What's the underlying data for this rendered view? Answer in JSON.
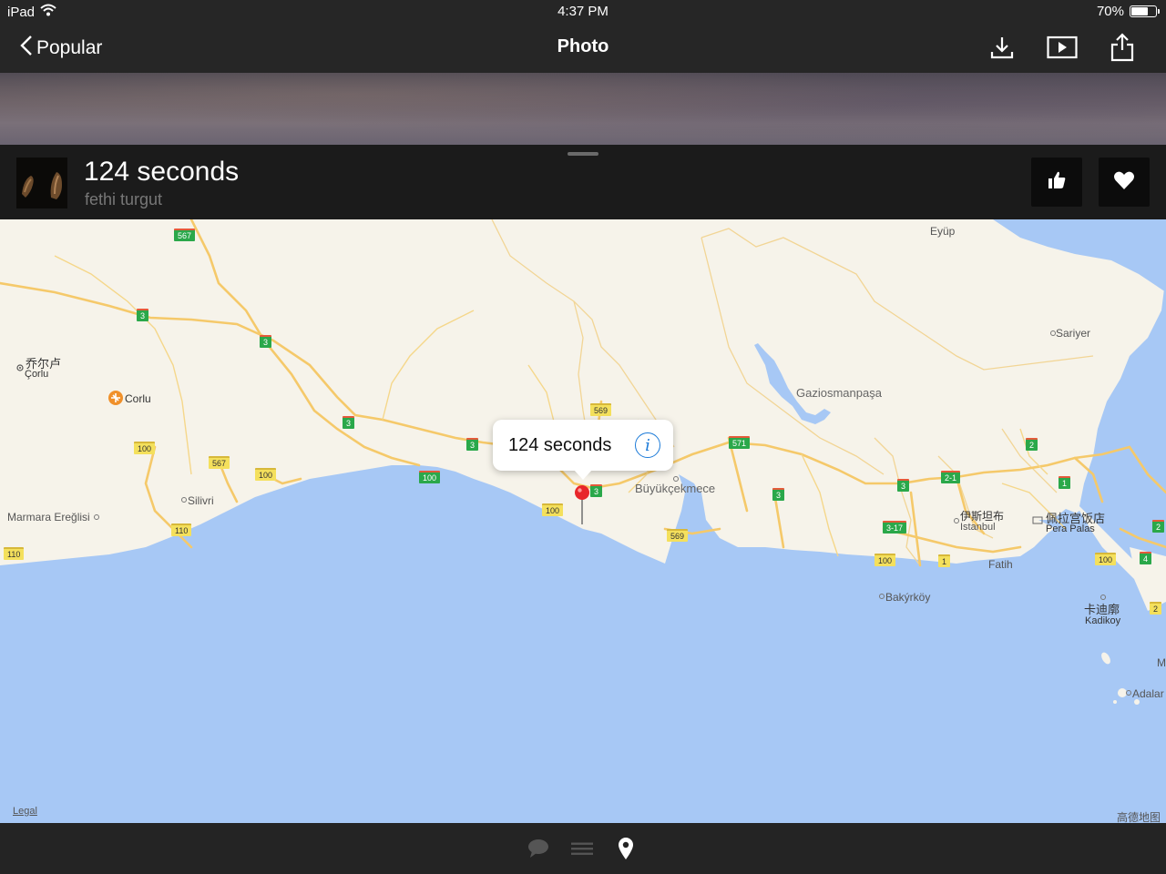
{
  "status": {
    "device": "iPad",
    "time": "4:37 PM",
    "battery_text": "70%",
    "battery_level": 0.7
  },
  "nav": {
    "back_label": "Popular",
    "title": "Photo",
    "icons": [
      "download-icon",
      "slideshow-icon",
      "share-icon"
    ]
  },
  "photo": {
    "title": "124 seconds",
    "author": "fethi turgut"
  },
  "actions": {
    "icons": [
      "thumbs-up-icon",
      "heart-icon"
    ]
  },
  "map": {
    "callout_title": "124 seconds",
    "legal": "Legal",
    "attribution": "高德地图",
    "places": {
      "eyup": "Eyüp",
      "sariyer": "Sariyer",
      "corlu_cn": "乔尔卢",
      "corlu": "Çorlu",
      "corlu_airport": "Corlu",
      "gaziosmanpasa": "Gaziosmanpaşa",
      "silivri": "Silivri",
      "marmara": "Marmara Ereğlisi",
      "buyukcekmece": "Büyükçekmece",
      "istanbul_cn": "伊斯坦布",
      "istanbul": "Istanbul",
      "pera_cn": "佩拉宫饭店",
      "pera": "Pera Palas",
      "fatih": "Fatih",
      "bakirkoy": "Bakýrköy",
      "kadikoy_cn": "卡迪廓",
      "kadikoy": "Kadikoy",
      "adalar": "Adalar",
      "m_edge": "M"
    },
    "roads": {
      "r567a": "567",
      "r3a": "3",
      "r3b": "3",
      "r3c": "3",
      "r569a": "569",
      "r100a": "100",
      "r567b": "567",
      "r100b": "100",
      "r3d": "3",
      "r100c": "100",
      "r3e": "3",
      "r100d": "100",
      "r571": "571",
      "r3f": "3",
      "r569b": "569",
      "r110a": "110",
      "r110b": "110",
      "r3g": "3",
      "r21": "2-1",
      "r2a": "2",
      "r1a": "1",
      "r317": "3-17",
      "r100e": "100",
      "r1b": "1",
      "r100f": "100",
      "r4": "4",
      "r2b": "2",
      "r2c": "2"
    }
  },
  "bottom": {
    "icons": [
      "comment-icon",
      "list-icon",
      "location-pin-icon"
    ]
  },
  "colors": {
    "bar_bg": "#262626",
    "panel_bg": "#1b1b1b",
    "sea": "#a7c8f5",
    "land": "#f6f3ea",
    "road": "#f5c96a",
    "accent_blue": "#1b7ad8",
    "pin_red": "#e8262b"
  }
}
